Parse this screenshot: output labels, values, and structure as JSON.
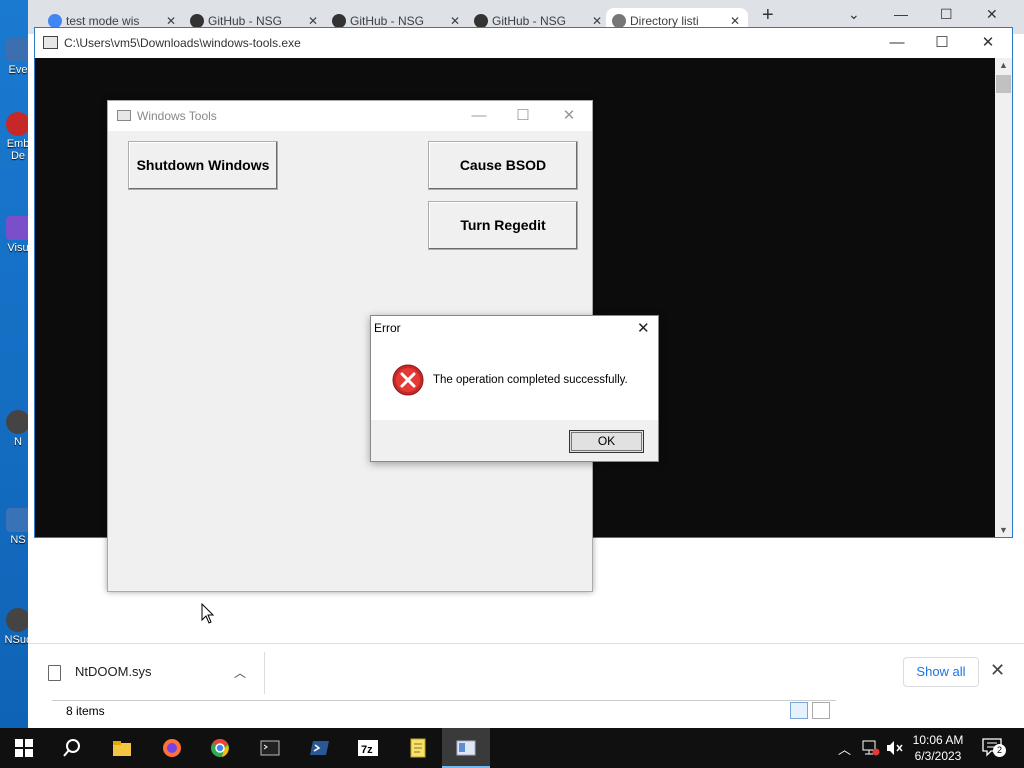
{
  "browser": {
    "tabs": [
      {
        "label": "test mode wis",
        "active": false
      },
      {
        "label": "GitHub - NSG",
        "active": false
      },
      {
        "label": "GitHub - NSG",
        "active": false
      },
      {
        "label": "GitHub - NSG",
        "active": false
      },
      {
        "label": "Directory listi",
        "active": true
      }
    ],
    "new_tab": "+"
  },
  "desktop": {
    "icons": [
      {
        "label": "Eve"
      },
      {
        "label": "Emb\nDe"
      },
      {
        "label": "Visu"
      },
      {
        "label": "N"
      },
      {
        "label": "NS"
      },
      {
        "label": "NSuc"
      }
    ]
  },
  "console": {
    "title": "C:\\Users\\vm5\\Downloads\\windows-tools.exe"
  },
  "tools_window": {
    "title": "Windows Tools",
    "buttons": {
      "shutdown": "Shutdown Windows",
      "bsod": "Cause BSOD",
      "regedit": "Turn Regedit"
    }
  },
  "error_dialog": {
    "title": "Error",
    "message": "The operation completed successfully.",
    "ok": "OK"
  },
  "download_bar": {
    "file": "NtDOOM.sys",
    "show_all": "Show all"
  },
  "explorer_status": {
    "items": "8 items"
  },
  "taskbar": {
    "apps": [
      "windows-start-icon",
      "search-icon",
      "file-explorer-icon",
      "firefox-icon",
      "chrome-icon",
      "terminal-icon",
      "powershell-icon",
      "7zip-icon",
      "notepad-icon",
      "windows-tools-icon"
    ],
    "time": "10:06 AM",
    "date": "6/3/2023",
    "notification_count": "2"
  },
  "colors": {
    "desktop": "#1a7ad0",
    "console_bg": "#0c0c0c",
    "error_red": "#d32f2f",
    "link_blue": "#1a73e8"
  }
}
